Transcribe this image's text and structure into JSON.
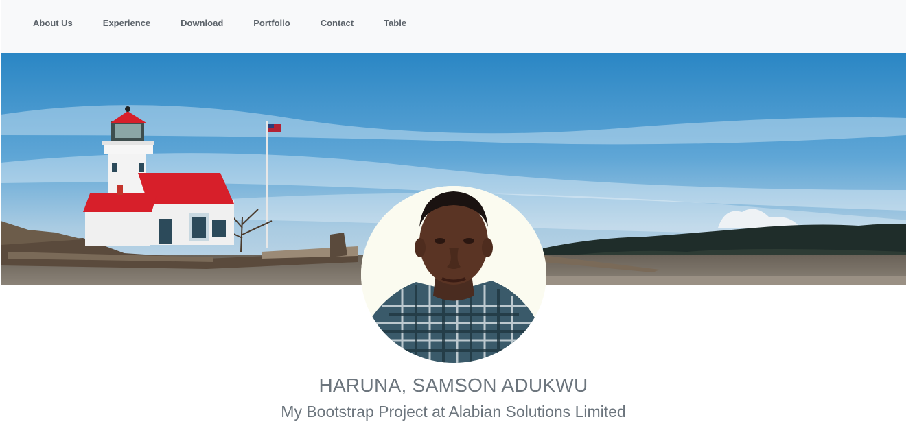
{
  "nav": {
    "items": [
      {
        "label": "About Us"
      },
      {
        "label": "Experience"
      },
      {
        "label": "Download"
      },
      {
        "label": "Portfolio"
      },
      {
        "label": "Contact"
      },
      {
        "label": "Table"
      }
    ]
  },
  "profile": {
    "name": "HARUNA, SAMSON ADUKWU",
    "subtitle": "My Bootstrap Project at Alabian Solutions Limited"
  },
  "colors": {
    "nav_bg": "#f8f9fa",
    "text_muted": "#6c757d",
    "sky": "#3a8fc7",
    "roof": "#d71f2a"
  }
}
